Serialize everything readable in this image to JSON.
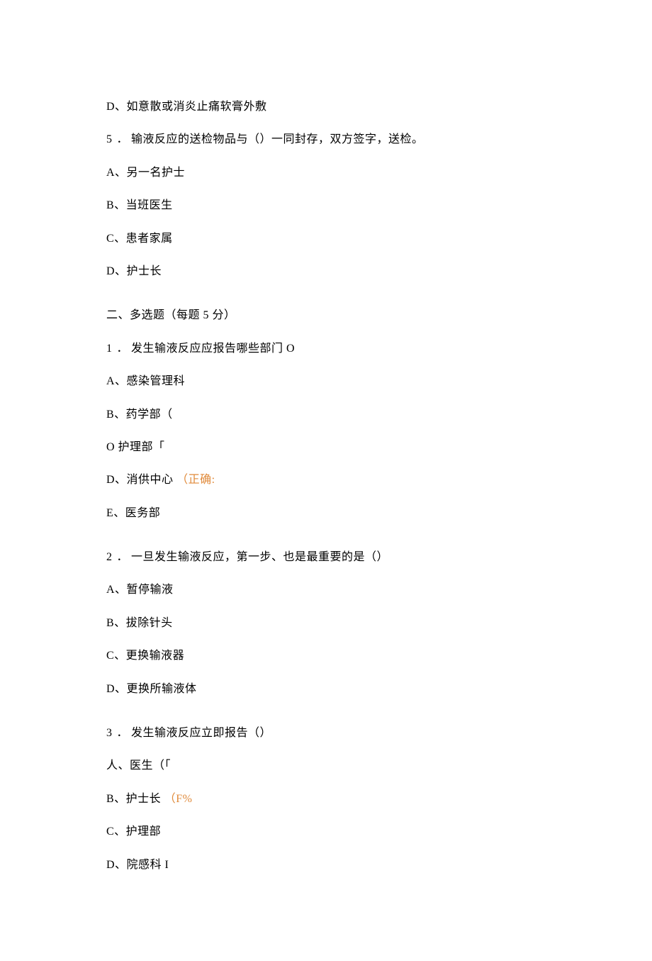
{
  "q_prev_optD": "D、如意散或消炎止痛软膏外敷",
  "q5": {
    "stem_pre": "5",
    "stem_dot": "．",
    "stem_post": "输液反应的送检物品与（）一同封存，双方签字，送检。",
    "A": "A、另一名护士",
    "B": "B、当班医生",
    "C": "C、患者家属",
    "D": "D、护士长"
  },
  "section2_title": "二、多选题（每题 5 分）",
  "mq1": {
    "stem_pre": "1",
    "stem_dot": "．",
    "stem_post": "发生输液反应应报告哪些部门 O",
    "A": "A、感染管理科",
    "B": "B、药学部（",
    "C": "O 护理部「",
    "D_text": "D、消供中心",
    "D_note": "（正确:",
    "E": "E、医务部"
  },
  "mq2": {
    "stem_pre": "2",
    "stem_dot": "．",
    "stem_post": "一旦发生输液反应，第一步、也是最重要的是（）",
    "A": "A、暂停输液",
    "B": "B、拔除针头",
    "C": "C、更换输液器",
    "D": "D、更换所输液体"
  },
  "mq3": {
    "stem_pre": "3",
    "stem_dot": "．",
    "stem_post": "发生输液反应立即报告（）",
    "A": "人、医生（「",
    "B_text": "B、护士长",
    "B_note": "（F%",
    "C": "C、护理部",
    "D": "D、院感科 I"
  }
}
